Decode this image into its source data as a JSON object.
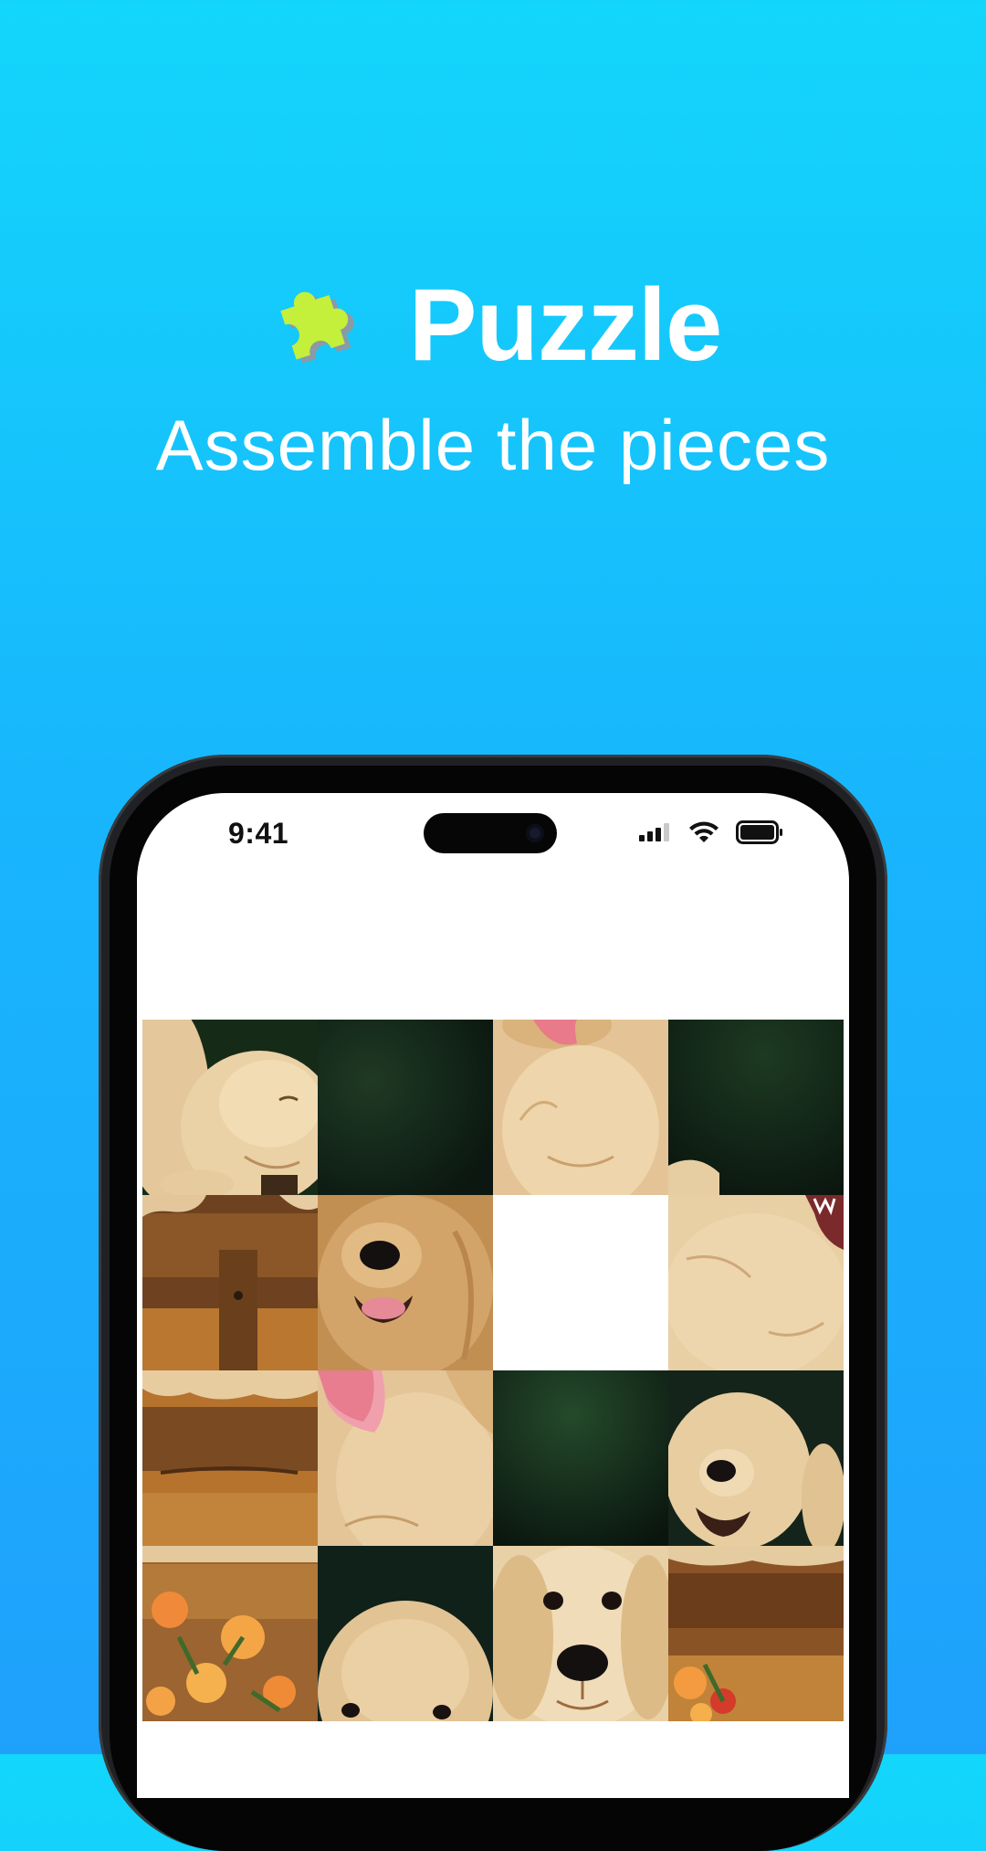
{
  "hero": {
    "title": "Puzzle",
    "subtitle": "Assemble the pieces",
    "logo_icon": "puzzle-piece-icon",
    "logo_color": "#c4ef3b"
  },
  "status_bar": {
    "time": "9:41",
    "icons": [
      "cellular-signal-icon",
      "wifi-icon",
      "battery-icon"
    ]
  },
  "board": {
    "rows": 4,
    "cols": 4,
    "empty_position": {
      "row": 1,
      "col": 2
    },
    "tiles": [
      {
        "content": "puppy-sleeping-on-bench"
      },
      {
        "content": "dark-green-background"
      },
      {
        "content": "puppy-chest-with-tongue"
      },
      {
        "content": "dark-green-background"
      },
      {
        "content": "wooden-bench-post"
      },
      {
        "content": "puppy-face-open-mouth"
      },
      {
        "content": "empty"
      },
      {
        "content": "puppy-fur-mouth-edge"
      },
      {
        "content": "puppy-paws-on-bench"
      },
      {
        "content": "puppy-tongue-out"
      },
      {
        "content": "dark-green-background"
      },
      {
        "content": "puppy-nose-side"
      },
      {
        "content": "orange-flowers-and-bench"
      },
      {
        "content": "puppy-head-top"
      },
      {
        "content": "puppy-face-front"
      },
      {
        "content": "bench-with-flowers"
      }
    ]
  },
  "colors": {
    "background_top": "#13d6fb",
    "background_bottom": "#1fa1fb",
    "fur_light": "#e9cf9f",
    "fur_mid": "#d2a96b",
    "foliage_dark": "#0f1d14",
    "wood": "#8a5526"
  }
}
